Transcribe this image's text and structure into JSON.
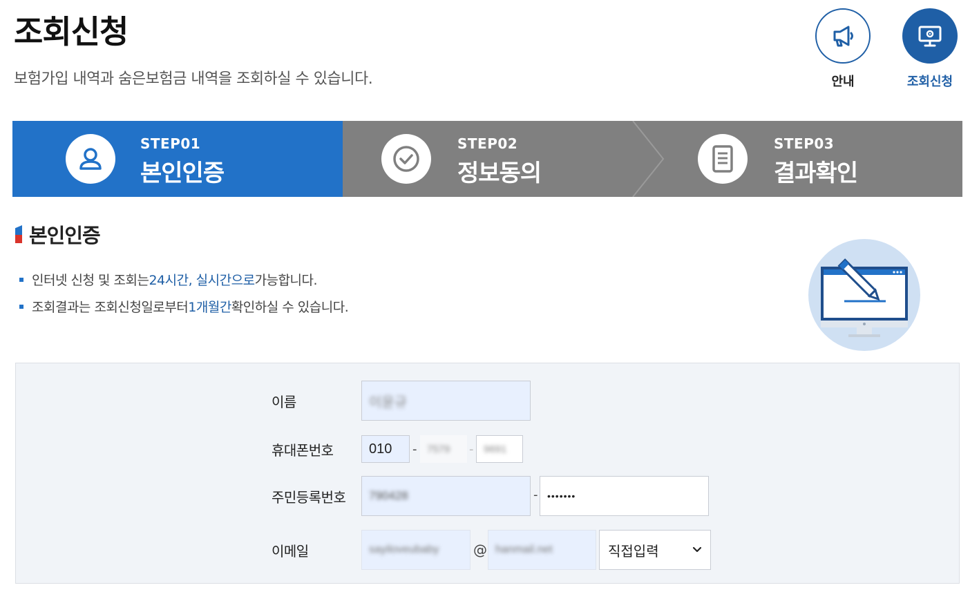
{
  "header": {
    "title": "조회신청",
    "subtitle": "보험가입 내역과 숨은보험금 내역을 조회하실 수 있습니다."
  },
  "top_buttons": {
    "guide_label": "안내",
    "inquiry_label": "조회신청",
    "guide_icon": "megaphone-icon",
    "inquiry_icon": "monitor-gear-icon"
  },
  "steps": [
    {
      "no": "STEP01",
      "name": "본인인증",
      "icon": "user-icon",
      "active": true
    },
    {
      "no": "STEP02",
      "name": "정보동의",
      "icon": "check-circle-icon",
      "active": false
    },
    {
      "no": "STEP03",
      "name": "결과확인",
      "icon": "document-icon",
      "active": false
    }
  ],
  "section": {
    "title": "본인인증",
    "bullet1": {
      "pre": "인터넷 신청 및 조회는 ",
      "hl": "24시간, 실시간으로",
      "post": " 가능합니다."
    },
    "bullet2": {
      "pre": "조회결과는 조회신청일로부터 ",
      "hl": "1개월간",
      "post": " 확인하실 수 있습니다."
    }
  },
  "form": {
    "name_label": "이름",
    "name_value": "이윤규",
    "phone_label": "휴대폰번호",
    "phone_prefix": "010",
    "phone_mid": "7579",
    "phone_last": "9691",
    "rrn_label": "주민등록번호",
    "rrn_front": "790428",
    "rrn_back": "•••••••",
    "email_label": "이메일",
    "email_id": "sayiloveubaby",
    "email_at": "@",
    "email_domain": "hanmail.net",
    "email_select": "직접입력",
    "dash": "-"
  },
  "colors": {
    "primary_blue": "#2272c8",
    "dark_blue": "#1f5fa6",
    "step_gray": "#808080",
    "form_bg": "#f1f4f8",
    "input_bg": "#e8f0fe"
  }
}
